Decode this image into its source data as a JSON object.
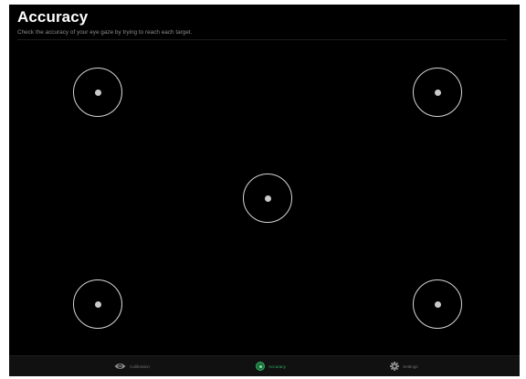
{
  "header": {
    "title": "Accuracy",
    "subtitle": "Check the accuracy of your eye gaze by trying to reach each target."
  },
  "targets": [
    {
      "name": "top-left"
    },
    {
      "name": "top-right"
    },
    {
      "name": "center"
    },
    {
      "name": "bottom-left"
    },
    {
      "name": "bottom-right"
    }
  ],
  "tabbar": {
    "tabs": [
      {
        "label": "Calibration",
        "icon": "eye-icon",
        "active": false
      },
      {
        "label": "Accuracy",
        "icon": "target-icon",
        "active": true
      },
      {
        "label": "Settings",
        "icon": "gear-icon",
        "active": false
      }
    ]
  },
  "colors": {
    "background": "#000000",
    "accent": "#2fae62",
    "target_ring": "#d6d6d6"
  }
}
